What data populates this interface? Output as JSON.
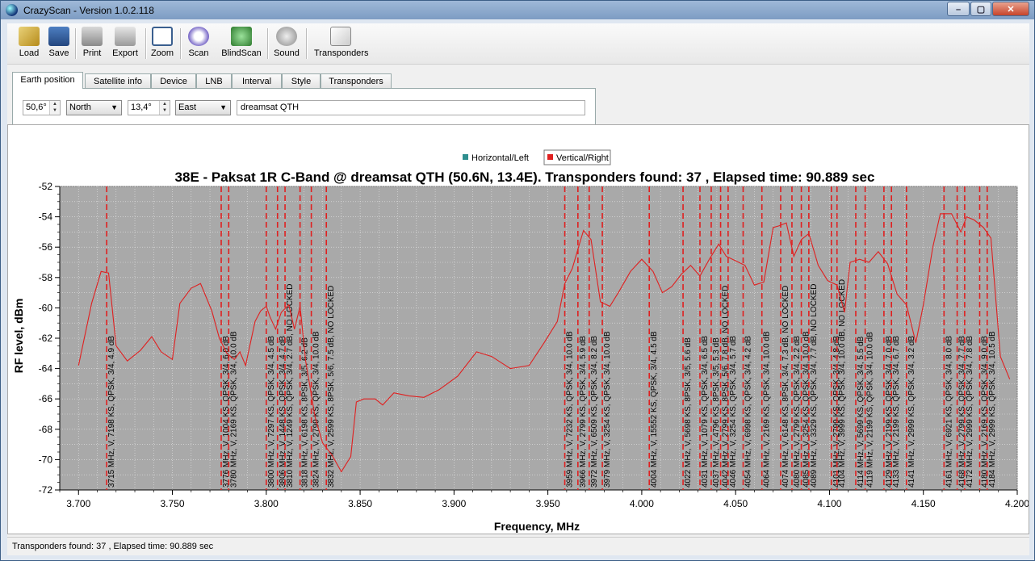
{
  "window": {
    "title": "CrazyScan - Version 1.0.2.118"
  },
  "toolbar": {
    "load": "Load",
    "save": "Save",
    "print": "Print",
    "export": "Export",
    "zoom": "Zoom",
    "scan": "Scan",
    "blindscan": "BlindScan",
    "sound": "Sound",
    "transponders": "Transponders"
  },
  "tabs": [
    "Earth position",
    "Satellite info",
    "Device",
    "LNB",
    "Interval",
    "Style",
    "Transponders"
  ],
  "earth_position": {
    "latitude": "50,6°",
    "lat_dir": "North",
    "longitude": "13,4°",
    "lon_dir": "East",
    "location_name": "dreamsat QTH"
  },
  "status": {
    "text": "Transponders found: 37 , Elapsed time: 90.889 sec"
  },
  "colors": {
    "plot_bg": "#a9a9a9",
    "curve": "#e02020",
    "legend_h": "#2f8f8f",
    "legend_v": "#e02020"
  },
  "chart_data": {
    "type": "line",
    "title": "38E - Paksat 1R C-Band @ dreamsat QTH (50.6N, 13.4E). Transponders found: 37 , Elapsed time: 90.889 sec",
    "xlabel": "Frequency, MHz",
    "ylabel": "RF level, dBm",
    "xlim": [
      3690,
      4200
    ],
    "ylim": [
      -72,
      -52
    ],
    "x_ticks": [
      3700,
      3750,
      3800,
      3850,
      3900,
      3950,
      4000,
      4050,
      4100,
      4150,
      4200
    ],
    "x_tick_labels": [
      "3.700",
      "3.750",
      "3.800",
      "3.850",
      "3.900",
      "3.950",
      "4.000",
      "4.050",
      "4.100",
      "4.150",
      "4.200"
    ],
    "y_ticks": [
      -52,
      -54,
      -56,
      -58,
      -60,
      -62,
      -64,
      -66,
      -68,
      -70,
      -72
    ],
    "y_tick_labels": [
      "-52",
      "-54",
      "-56",
      "-58",
      "-60",
      "-62",
      "-64",
      "-66",
      "-68",
      "-70",
      "-72"
    ],
    "legend": [
      "Horizontal/Left",
      "Vertical/Right"
    ],
    "grid": true,
    "series": [
      {
        "name": "Vertical/Right",
        "points": [
          [
            3700,
            -63.8
          ],
          [
            3707,
            -59.7
          ],
          [
            3712,
            -57.6
          ],
          [
            3716,
            -57.7
          ],
          [
            3720,
            -62.5
          ],
          [
            3726,
            -63.5
          ],
          [
            3733,
            -62.8
          ],
          [
            3739,
            -61.9
          ],
          [
            3744,
            -62.9
          ],
          [
            3750,
            -63.4
          ],
          [
            3754,
            -59.7
          ],
          [
            3760,
            -58.7
          ],
          [
            3765,
            -58.4
          ],
          [
            3771,
            -60.2
          ],
          [
            3775,
            -62.0
          ],
          [
            3779,
            -63.0
          ],
          [
            3783,
            -63.4
          ],
          [
            3786,
            -62.9
          ],
          [
            3789,
            -63.8
          ],
          [
            3794,
            -60.9
          ],
          [
            3797,
            -60.2
          ],
          [
            3800,
            -59.9
          ],
          [
            3802,
            -60.6
          ],
          [
            3805,
            -61.4
          ],
          [
            3808,
            -60.3
          ],
          [
            3812,
            -59.8
          ],
          [
            3815,
            -61.4
          ],
          [
            3818,
            -59.9
          ],
          [
            3821,
            -63.5
          ],
          [
            3826,
            -67.2
          ],
          [
            3830,
            -68.9
          ],
          [
            3835,
            -69.7
          ],
          [
            3840,
            -70.8
          ],
          [
            3845,
            -69.8
          ],
          [
            3848,
            -66.2
          ],
          [
            3852,
            -66.0
          ],
          [
            3858,
            -66.0
          ],
          [
            3862,
            -66.4
          ],
          [
            3868,
            -65.6
          ],
          [
            3876,
            -65.8
          ],
          [
            3884,
            -65.9
          ],
          [
            3892,
            -65.4
          ],
          [
            3902,
            -64.5
          ],
          [
            3912,
            -62.9
          ],
          [
            3920,
            -63.2
          ],
          [
            3930,
            -64.0
          ],
          [
            3940,
            -63.8
          ],
          [
            3948,
            -62.3
          ],
          [
            3955,
            -60.9
          ],
          [
            3959,
            -58.4
          ],
          [
            3963,
            -57.4
          ],
          [
            3967,
            -55.7
          ],
          [
            3969,
            -54.9
          ],
          [
            3973,
            -55.5
          ],
          [
            3978,
            -59.6
          ],
          [
            3983,
            -59.9
          ],
          [
            3988,
            -58.9
          ],
          [
            3994,
            -57.6
          ],
          [
            4000,
            -56.8
          ],
          [
            4006,
            -57.6
          ],
          [
            4011,
            -59.0
          ],
          [
            4016,
            -58.6
          ],
          [
            4021,
            -57.8
          ],
          [
            4026,
            -57.2
          ],
          [
            4031,
            -57.9
          ],
          [
            4036,
            -56.8
          ],
          [
            4041,
            -55.8
          ],
          [
            4045,
            -56.6
          ],
          [
            4050,
            -56.9
          ],
          [
            4055,
            -57.2
          ],
          [
            4060,
            -58.5
          ],
          [
            4065,
            -58.3
          ],
          [
            4070,
            -54.7
          ],
          [
            4073,
            -54.6
          ],
          [
            4077,
            -54.4
          ],
          [
            4081,
            -56.6
          ],
          [
            4085,
            -55.5
          ],
          [
            4089,
            -55.1
          ],
          [
            4094,
            -57.2
          ],
          [
            4099,
            -58.2
          ],
          [
            4104,
            -58.5
          ],
          [
            4108,
            -60.3
          ],
          [
            4111,
            -57.0
          ],
          [
            4116,
            -56.8
          ],
          [
            4121,
            -57.0
          ],
          [
            4126,
            -56.3
          ],
          [
            4131,
            -57.1
          ],
          [
            4136,
            -59.1
          ],
          [
            4141,
            -59.8
          ],
          [
            4146,
            -62.3
          ],
          [
            4150,
            -59.8
          ],
          [
            4155,
            -56.0
          ],
          [
            4159,
            -53.8
          ],
          [
            4165,
            -53.8
          ],
          [
            4170,
            -55.0
          ],
          [
            4173,
            -54.0
          ],
          [
            4177,
            -54.2
          ],
          [
            4182,
            -54.7
          ],
          [
            4186,
            -55.4
          ],
          [
            4191,
            -63.2
          ],
          [
            4196,
            -64.7
          ]
        ]
      }
    ],
    "transponder_labels": [
      {
        "f": 3715,
        "label": "3715 MHz, V, 7198 KS, QPSK, 3/4, 4.9 dB"
      },
      {
        "f": 3776,
        "label": "3776 MHz, V, 1004 KS, QPSK, 3/4, 6.0 dB"
      },
      {
        "f": 3780,
        "label": "3780 MHz, V, 2169 KS, QPSK, 3/4, 10.0 dB"
      },
      {
        "f": 3800,
        "label": "3800 MHz, V, 7297 KS, QPSK, 3/4, 4.5 dB"
      },
      {
        "f": 3806,
        "label": "3806 MHz, V, 1448 KS, QPSK, 3/4, 4.7 dB"
      },
      {
        "f": 3810,
        "label": "3810 MHz, V, 1249 KS, QPSK, 3/4, 2.7 dB, NO LOCKED"
      },
      {
        "f": 3818,
        "label": "3818 MHz, V, 6198 KS, 8PSK, 3/5, 6.2 dB"
      },
      {
        "f": 3824,
        "label": "3824 MHz, V, 2799 KS, QPSK, 3/4, 10.0 dB"
      },
      {
        "f": 3832,
        "label": "3832 MHz, V, 2599 KS, 8PSK, 5/6, 7.5 dB, NO LOCKED"
      },
      {
        "f": 3959,
        "label": "3959 MHz, V, 7232 KS, QPSK, 3/4, 10.0 dB"
      },
      {
        "f": 3966,
        "label": "3966 MHz, V, 2799 KS, QPSK, 3/4, 5.9 dB"
      },
      {
        "f": 3972,
        "label": "3972 MHz, V, 6509 KS, QPSK, 3/4, 8.2 dB"
      },
      {
        "f": 3979,
        "label": "3979 MHz, V, 3254 KS, QPSK, 3/4, 10.0 dB"
      },
      {
        "f": 4004,
        "label": "4004 MHz, V, 15552 KS, QPSK, 3/4, 4.5 dB"
      },
      {
        "f": 4022,
        "label": "4022 MHz, V, 5698 KS, 8PSK, 3/5, 5.6 dB"
      },
      {
        "f": 4031,
        "label": "4031 MHz, V, 1079 KS, QPSK, 3/4, 6.5 dB"
      },
      {
        "f": 4037,
        "label": "4037 MHz, V, 4796 KS, 8PSK, 3/5, 5.3 dB"
      },
      {
        "f": 4042,
        "label": "4042 MHz, V, 2799 KS, 8PSK, 5/6, 7.8 dB, NO LOCKED"
      },
      {
        "f": 4046,
        "label": "4046 MHz, V, 3254 KS, QPSK, 3/4, 5.7 dB"
      },
      {
        "f": 4054,
        "label": "4054 MHz, V, 6998 KS, QPSK, 3/4, 4.2 dB"
      },
      {
        "f": 4064,
        "label": "4064 MHz, V, 2169 KS, QPSK, 3/4, 10.0 dB"
      },
      {
        "f": 4074,
        "label": "4074 MHz, V, 6148 KS, 8PSK, 3/4, 7.3 dB, NO LOCKED"
      },
      {
        "f": 4080,
        "label": "4080 MHz, V, 2799 KS, QPSK, 3/4, 2.2 dB"
      },
      {
        "f": 4085,
        "label": "4085 MHz, V, 3254 KS, QPSK, 3/4, 10.0 dB"
      },
      {
        "f": 4089,
        "label": "4089 MHz, V, 3329 KS, QPSK, 3/4, 7.7 dB, NO LOCKED"
      },
      {
        "f": 4101,
        "label": "4101 MHz, V, 2799 KS, QPSK, 3/4, 4.8 dB"
      },
      {
        "f": 4104,
        "label": "4104 MHz, V, 3999 KS, QPSK, 3/4, 10.0 dB, NO LOCKED"
      },
      {
        "f": 4114,
        "label": "4114 MHz, V, 5699 KS, QPSK, 3/4, 5.5 dB"
      },
      {
        "f": 4119,
        "label": "4119 MHz, V, 2199 KS, QPSK, 3/4, 10.0 dB"
      },
      {
        "f": 4129,
        "label": "4129 MHz, V, 2199 KS, QPSK, 3/4, 7.0 dB"
      },
      {
        "f": 4133,
        "label": "4133 MHz, V, 2199 KS, QPSK, 3/4, 6.7 dB"
      },
      {
        "f": 4141,
        "label": "4141 MHz, V, 2999 KS, QPSK, 3/4, 3.2 dB"
      },
      {
        "f": 4161,
        "label": "4161 MHz, V, 6921 KS, QPSK, 3/4, 8.0 dB"
      },
      {
        "f": 4168,
        "label": "4168 MHz, V, 2799 KS, QPSK, 3/4, 7.7 dB"
      },
      {
        "f": 4172,
        "label": "4172 MHz, V, 2999 KS, QPSK, 3/4, 7.8 dB"
      },
      {
        "f": 4180,
        "label": "4180 MHz, V, 2169 KS, QPSK, 3/4, 9.0 dB"
      },
      {
        "f": 4184,
        "label": "4184 MHz, V, 2999 KS, QPSK, 3/4, 10.5 dB"
      }
    ]
  }
}
